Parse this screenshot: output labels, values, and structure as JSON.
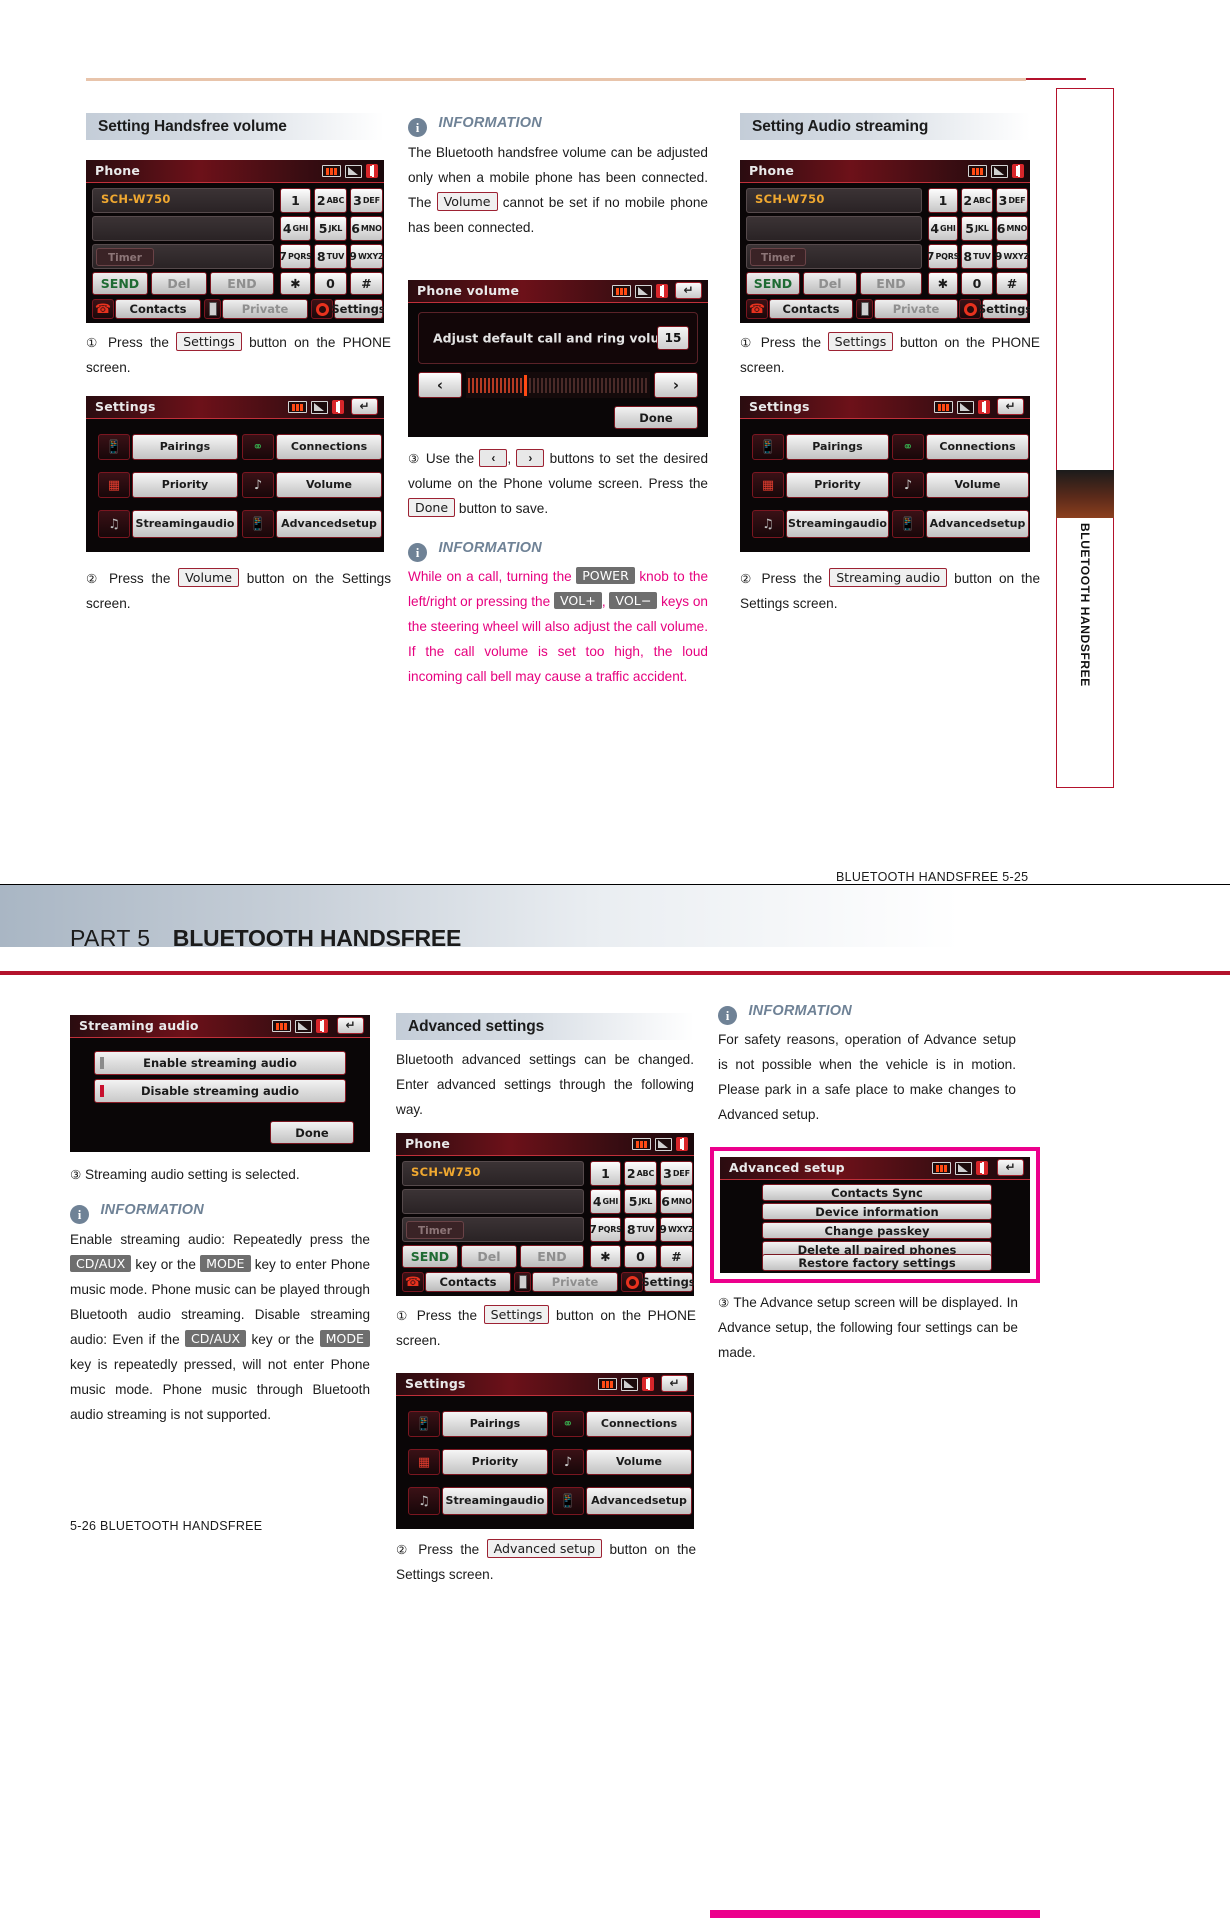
{
  "page1": {
    "footer": "BLUETOOTH HANDSFREE    5-25",
    "side_tab": "BLUETOOTH HANDSFREE",
    "col1": {
      "heading": "Setting Handsfree volume",
      "step1": {
        "num": "①",
        "pre": "Press the",
        "chip": "Settings",
        "post": "button on the PHONE screen."
      },
      "step2": {
        "num": "②",
        "pre": "Press the",
        "chip": "Volume",
        "post": "button on the Settings screen."
      }
    },
    "col2": {
      "info1": {
        "title": "INFORMATION",
        "l1": "The Bluetooth handsfree volume can be",
        "l2": "adjusted only when a mobile phone has been",
        "l3": "connected.",
        "l4_pre": "The",
        "l4_chip": "Volume",
        "l4_post": "cannot be set if no mobile",
        "l5": "phone has been connected."
      },
      "step3": {
        "num": "③",
        "pre": "Use the",
        "chip_left": "‹",
        "chip_right": "›",
        "mid": "buttons to set the desired volume on the Phone volume screen. Press the",
        "chip_done": "Done",
        "post": "button to save."
      },
      "info2": {
        "title": "INFORMATION",
        "l1_a": "While on a call, turning the",
        "l1_chip": "POWER",
        "l1_b": "knob to the left/right or pressing the",
        "l2_chip_a": "VOL+",
        "l2_chip_b": "VOL−",
        "l2_b": "keys on the steering wheel will also adjust the call volume.",
        "l3": "If the call volume is set too high, the loud incoming call bell may cause a traffic accident."
      }
    },
    "col3": {
      "heading": "Setting Audio streaming",
      "step1": {
        "num": "①",
        "pre": "Press the",
        "chip": "Settings",
        "post": "button on the PHONE screen."
      },
      "step2": {
        "num": "②",
        "pre": "Press the",
        "chip": "Streaming audio",
        "post": "button on the Settings screen."
      }
    }
  },
  "page2": {
    "part_label": "PART 5",
    "part_title": "BLUETOOTH HANDSFREE",
    "footer": "5-26   BLUETOOTH HANDSFREE",
    "col1": {
      "step3": {
        "num": "③",
        "text": "Streaming audio setting is selected."
      },
      "info": {
        "title": "INFORMATION",
        "l1": "Enable streaming audio: Repeatedly press the",
        "chip_cdaux": "CD/AUX",
        "l2_a": "key or the",
        "chip_mode": "MODE",
        "l2_b": "key to enter Phone music mode. Phone music can be played through Bluetooth audio streaming.",
        "l3_a": "Disable streaming audio: Even if the",
        "chip_cdaux2": "CD/AUX",
        "l3_b": "key or the",
        "chip_mode2": "MODE",
        "l3_c": "key is repeatedly pressed, will not enter Phone music mode. Phone music through Bluetooth audio streaming is not supported."
      }
    },
    "col2": {
      "heading": "Advanced settings",
      "intro": "Bluetooth advanced settings can be changed. Enter advanced settings through the following way.",
      "step1": {
        "num": "①",
        "pre": "Press the",
        "chip": "Settings",
        "post": "button on the PHONE screen."
      },
      "step2": {
        "num": "②",
        "pre": "Press the",
        "chip": "Advanced setup",
        "post": "button on the Settings screen."
      }
    },
    "col3": {
      "info": {
        "title": "INFORMATION",
        "text": "For safety reasons, operation of Advance setup is not possible when the vehicle is in motion. Please park in a safe place to make changes to Advanced setup."
      },
      "step3": {
        "num": "③",
        "text": "The Advance setup screen will be displayed. In Advance setup, the following four settings can be made."
      }
    }
  },
  "screens": {
    "phone": {
      "title": "Phone",
      "device": "SCH-W750",
      "timer": "Timer",
      "keys": [
        {
          "d": "1",
          "s": ""
        },
        {
          "d": "2",
          "s": "ABC"
        },
        {
          "d": "3",
          "s": "DEF"
        },
        {
          "d": "4",
          "s": "GHI"
        },
        {
          "d": "5",
          "s": "JKL"
        },
        {
          "d": "6",
          "s": "MNO"
        },
        {
          "d": "7",
          "s": "PQRS"
        },
        {
          "d": "8",
          "s": "TUV"
        },
        {
          "d": "9",
          "s": "WXYZ"
        },
        {
          "d": "✱",
          "s": ""
        },
        {
          "d": "0",
          "s": ""
        },
        {
          "d": "#",
          "s": ""
        }
      ],
      "send": "SEND",
      "del": "Del",
      "end": "END",
      "contacts": "Contacts",
      "private": "Private",
      "settings": "Settings"
    },
    "settings": {
      "title": "Settings",
      "tiles": [
        "Pairings",
        "Connections",
        "Priority",
        "Volume",
        "Streaming audio",
        "Advanced setup"
      ]
    },
    "phone_volume": {
      "title": "Phone volume",
      "prompt": "Adjust default call and ring volume",
      "value": "15",
      "left_arrow": "‹",
      "right_arrow": "›",
      "done": "Done"
    },
    "streaming_audio": {
      "title": "Streaming audio",
      "enable": "Enable streaming audio",
      "disable": "Disable streaming audio",
      "done": "Done"
    },
    "advanced_setup": {
      "title": "Advanced setup",
      "rows": [
        "Contacts Sync",
        "Device information",
        "Change passkey",
        "Delete all paired phones",
        "Restore factory settings"
      ]
    }
  }
}
